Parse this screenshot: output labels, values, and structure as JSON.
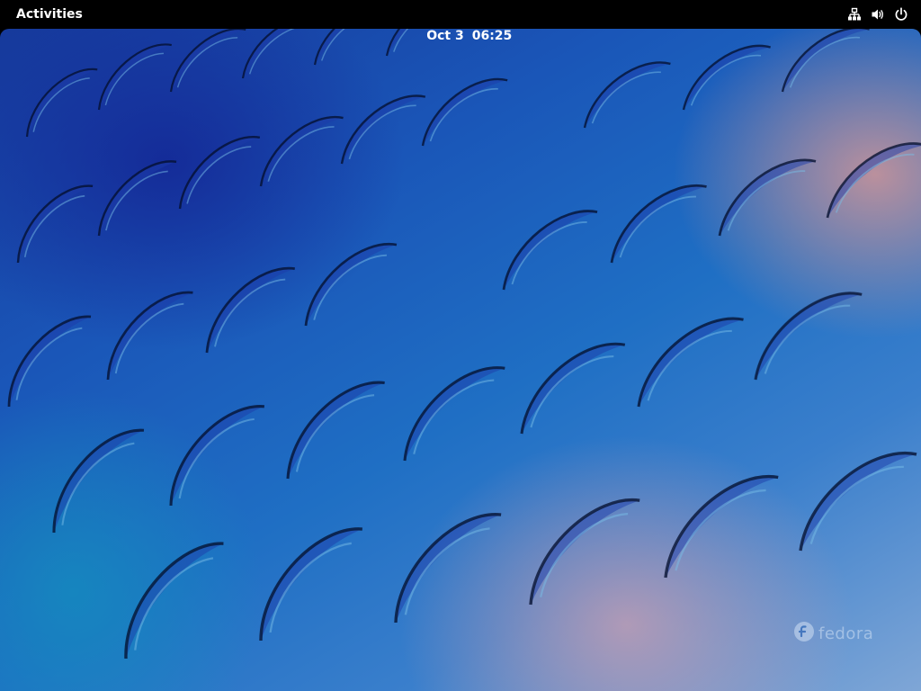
{
  "top_bar": {
    "activities_label": "Activities",
    "clock": {
      "date": "Oct 3",
      "time": "06:25"
    },
    "status_icons": [
      "network-wired-icon",
      "volume-icon",
      "power-icon"
    ]
  },
  "desktop": {
    "watermark_text": "fedora",
    "colors": {
      "top_bar": "#000000",
      "wallpaper_deep_blue": "#163a9c",
      "wallpaper_cyan": "#1f8fc4",
      "wallpaper_pink": "#d69696"
    }
  }
}
